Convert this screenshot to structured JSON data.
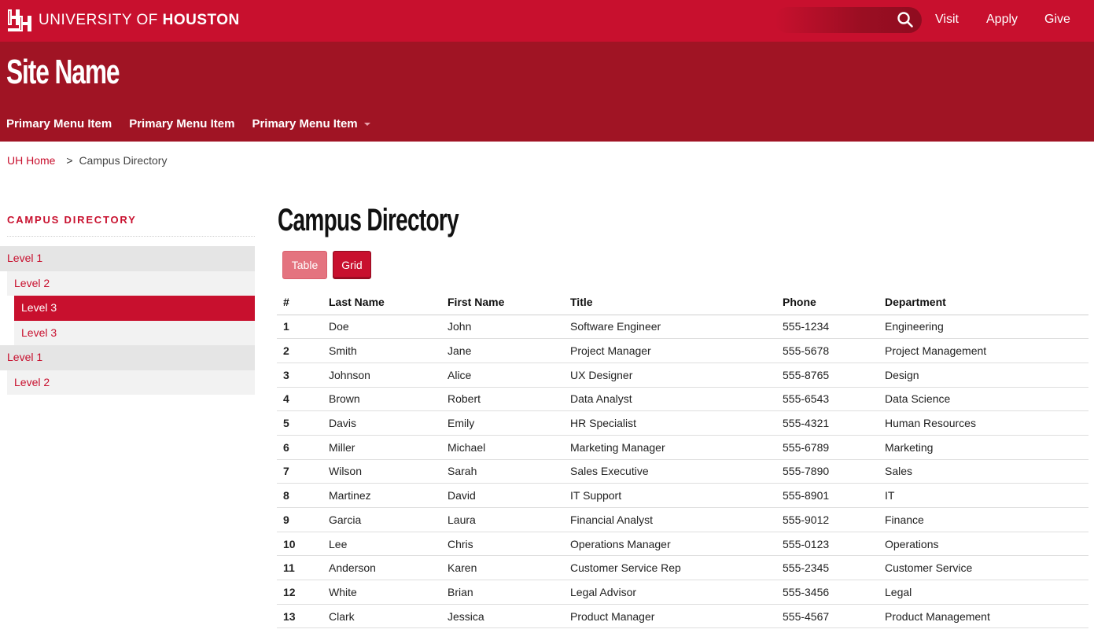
{
  "brand": {
    "name_light": "UNIVERSITY OF",
    "name_bold": "HOUSTON",
    "logo_icon": "uh-interlocking-logo",
    "colors": {
      "primary": "#c8102e",
      "dark": "#a01424"
    }
  },
  "utility_nav": {
    "search_icon": "search-icon",
    "links": [
      "Visit",
      "Apply",
      "Give"
    ]
  },
  "site": {
    "name": "Site Name",
    "primary_menu": [
      {
        "label": "Primary Menu Item",
        "has_dropdown": false
      },
      {
        "label": "Primary Menu Item",
        "has_dropdown": false
      },
      {
        "label": "Primary Menu Item",
        "has_dropdown": true
      }
    ]
  },
  "breadcrumb": {
    "home": "UH Home",
    "separator": ">",
    "current": "Campus Directory"
  },
  "sidebar": {
    "title": "CAMPUS DIRECTORY",
    "items": [
      {
        "label": "Level 1",
        "level": 1
      },
      {
        "label": "Level 2",
        "level": 2
      },
      {
        "label": "Level 3",
        "level": 3,
        "active": true
      },
      {
        "label": "Level 3",
        "level": 3
      },
      {
        "label": "Level 1",
        "level": 1
      },
      {
        "label": "Level 2",
        "level": 2
      }
    ]
  },
  "main": {
    "title": "Campus Directory",
    "view_buttons": {
      "table": "Table",
      "grid": "Grid"
    },
    "table": {
      "headers": [
        "#",
        "Last Name",
        "First Name",
        "Title",
        "Phone",
        "Department"
      ],
      "rows": [
        [
          "1",
          "Doe",
          "John",
          "Software Engineer",
          "555-1234",
          "Engineering"
        ],
        [
          "2",
          "Smith",
          "Jane",
          "Project Manager",
          "555-5678",
          "Project Management"
        ],
        [
          "3",
          "Johnson",
          "Alice",
          "UX Designer",
          "555-8765",
          "Design"
        ],
        [
          "4",
          "Brown",
          "Robert",
          "Data Analyst",
          "555-6543",
          "Data Science"
        ],
        [
          "5",
          "Davis",
          "Emily",
          "HR Specialist",
          "555-4321",
          "Human Resources"
        ],
        [
          "6",
          "Miller",
          "Michael",
          "Marketing Manager",
          "555-6789",
          "Marketing"
        ],
        [
          "7",
          "Wilson",
          "Sarah",
          "Sales Executive",
          "555-7890",
          "Sales"
        ],
        [
          "8",
          "Martinez",
          "David",
          "IT Support",
          "555-8901",
          "IT"
        ],
        [
          "9",
          "Garcia",
          "Laura",
          "Financial Analyst",
          "555-9012",
          "Finance"
        ],
        [
          "10",
          "Lee",
          "Chris",
          "Operations Manager",
          "555-0123",
          "Operations"
        ],
        [
          "11",
          "Anderson",
          "Karen",
          "Customer Service Rep",
          "555-2345",
          "Customer Service"
        ],
        [
          "12",
          "White",
          "Brian",
          "Legal Advisor",
          "555-3456",
          "Legal"
        ],
        [
          "13",
          "Clark",
          "Jessica",
          "Product Manager",
          "555-4567",
          "Product Management"
        ]
      ]
    }
  }
}
